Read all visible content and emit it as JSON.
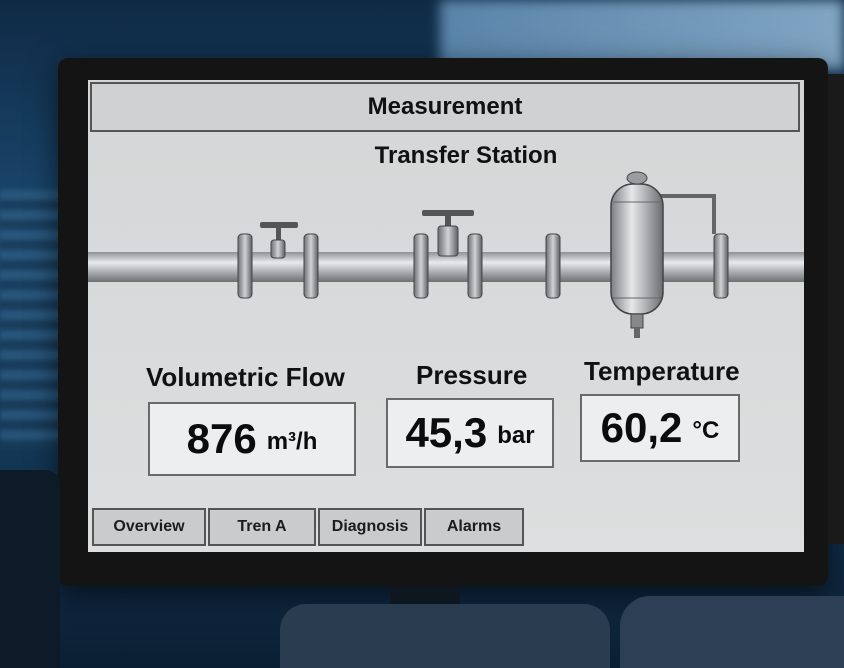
{
  "screen": {
    "header_title": "Measurement",
    "station_title": "Transfer Station"
  },
  "metrics": {
    "flow": {
      "label": "Volumetric Flow",
      "value": "876",
      "unit": "m³/h"
    },
    "pressure": {
      "label": "Pressure",
      "value": "45,3",
      "unit": "bar"
    },
    "temperature": {
      "label": "Temperature",
      "value": "60,2",
      "unit": "°C"
    }
  },
  "tabs": [
    {
      "label": "Overview"
    },
    {
      "label": "Tren A"
    },
    {
      "label": "Diagnosis"
    },
    {
      "label": "Alarms"
    }
  ],
  "colors": {
    "screen_bg": "#d8dadb",
    "pipe": "#a9acae",
    "frame": "#141414"
  }
}
